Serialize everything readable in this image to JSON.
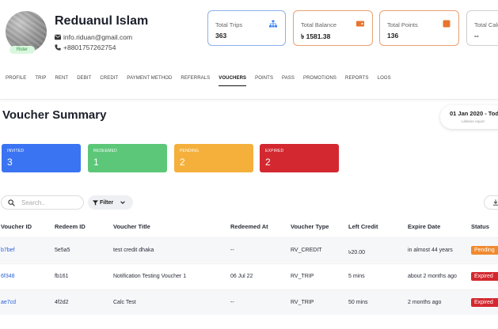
{
  "profile": {
    "name": "Reduanul Islam",
    "email": "info.riduan@gmail.com",
    "phone": "+8801757262754",
    "role": "Rider"
  },
  "stats": [
    {
      "label": "Total Trips",
      "value": "363",
      "icon": "sitemap-icon",
      "color": "#3b82f6"
    },
    {
      "label": "Total Balance",
      "value": "৳ 1581.38",
      "icon": "wallet-icon",
      "color": "#e8742d"
    },
    {
      "label": "Total Points",
      "value": "136",
      "icon": "points-icon",
      "color": "#e8742d"
    },
    {
      "label": "Total Calc",
      "value": "--",
      "icon": "calc-icon",
      "color": "#999999"
    }
  ],
  "tabs": [
    "PROFILE",
    "TRIP",
    "RENT",
    "DEBIT",
    "CREDIT",
    "PAYMENT METHOD",
    "REFERRALS",
    "VOUCHERS",
    "POINTS",
    "PASS",
    "PROMOTIONS",
    "REPORTS",
    "LOGS"
  ],
  "active_tab": "VOUCHERS",
  "summary": {
    "title": "Voucher Summary",
    "date_range": "01 Jan 2020 - Tod",
    "date_sub": "Lifetime report",
    "cards": [
      {
        "label": "INVITED",
        "value": "3",
        "color": "#3b74f2"
      },
      {
        "label": "REDEEMED",
        "value": "1",
        "color": "#5cc778"
      },
      {
        "label": "PENDING",
        "value": "2",
        "color": "#f4b03b"
      },
      {
        "label": "EXPIRED",
        "value": "2",
        "color": "#d3282f"
      }
    ]
  },
  "toolbar": {
    "search_placeholder": "Search..",
    "filter_label": "Filter"
  },
  "table": {
    "headers": [
      "Voucher ID",
      "Redeem ID",
      "Voucher Title",
      "Redeemed At",
      "Voucher Type",
      "Left Credit",
      "Expire Date",
      "Status"
    ],
    "rows": [
      {
        "voucher_id": "b7bef",
        "redeem_id": "5e5a5",
        "title": "test credit dhaka",
        "redeemed_at": "--",
        "type": "RV_CREDIT",
        "left_credit": "৳20.00",
        "expire": "in almost 44 years",
        "status": "Pending",
        "status_color": "#f08a2f"
      },
      {
        "voucher_id": "6f348",
        "redeem_id": "fb161",
        "title": "Notification Testing Voucher 1",
        "redeemed_at": "06 Jul 22",
        "type": "RV_TRIP",
        "left_credit": "5 mins",
        "expire": "about 2 months ago",
        "status": "Expired",
        "status_color": "#d3282f"
      },
      {
        "voucher_id": "ae7cd",
        "redeem_id": "4f2d2",
        "title": "Calc Test",
        "redeemed_at": "--",
        "type": "RV_TRIP",
        "left_credit": "50 mins",
        "expire": "2 months ago",
        "status": "Expired",
        "status_color": "#d3282f"
      }
    ]
  }
}
